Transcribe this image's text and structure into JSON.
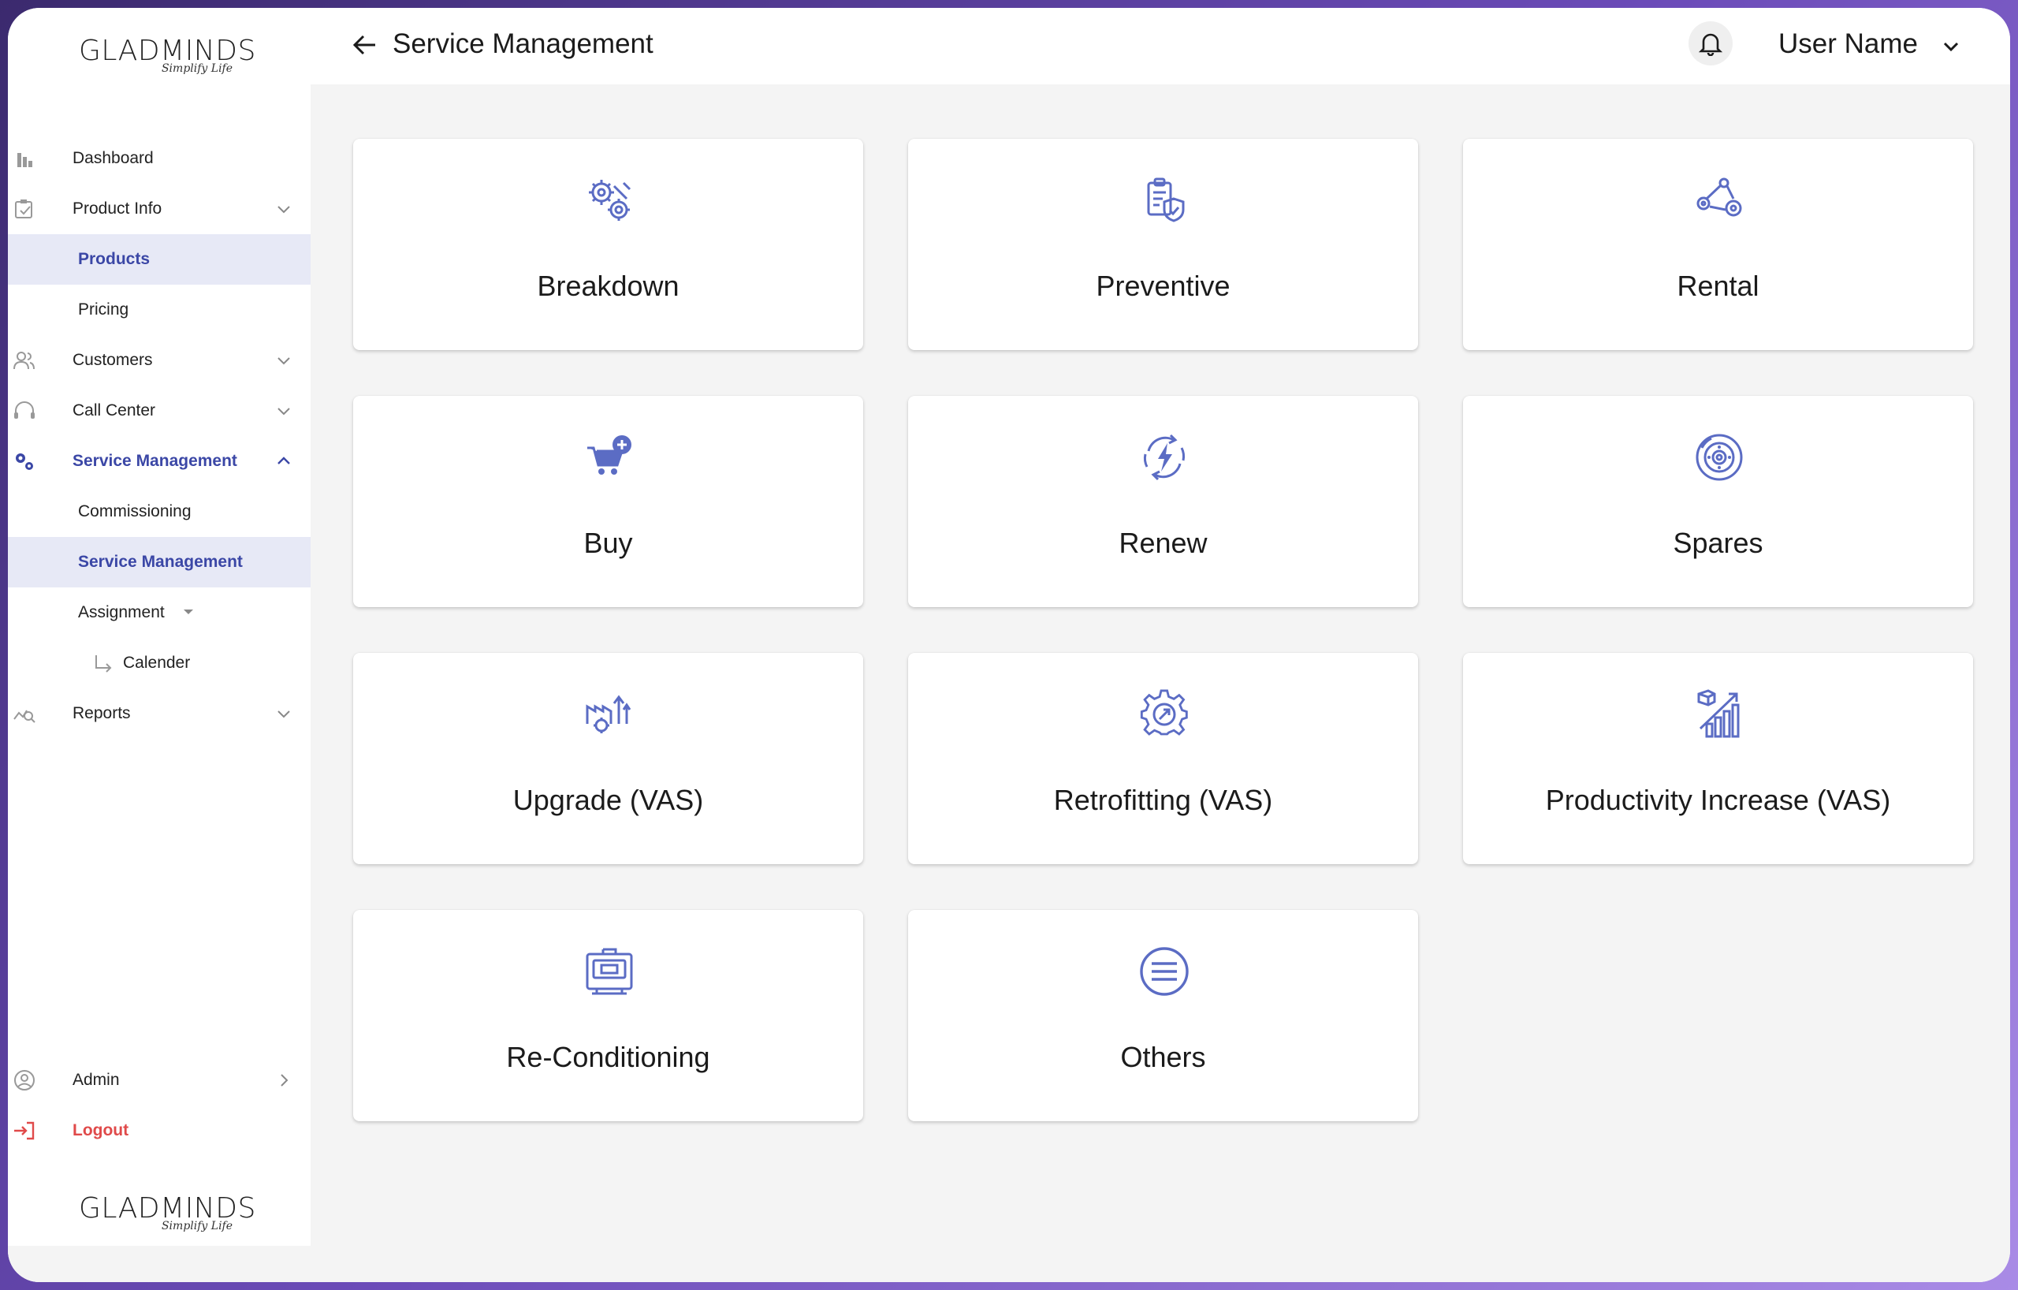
{
  "brand": {
    "name": "GLADMINDS",
    "tagline": "Simplify Life"
  },
  "header": {
    "title": "Service Management",
    "user_name": "User Name"
  },
  "sidebar": {
    "items": [
      {
        "label": "Dashboard"
      },
      {
        "label": "Product Info"
      },
      {
        "label": "Products"
      },
      {
        "label": "Pricing"
      },
      {
        "label": "Customers"
      },
      {
        "label": "Call Center"
      },
      {
        "label": "Service Management"
      },
      {
        "label": "Commissioning"
      },
      {
        "label": "Service Management"
      },
      {
        "label": "Assignment"
      },
      {
        "label": "Calender"
      },
      {
        "label": "Reports"
      }
    ],
    "admin": "Admin",
    "logout": "Logout"
  },
  "cards": [
    {
      "label": "Breakdown",
      "icon": "gears-wrench-icon"
    },
    {
      "label": "Preventive",
      "icon": "clipboard-shield-icon"
    },
    {
      "label": "Rental",
      "icon": "robot-arm-icon"
    },
    {
      "label": "Buy",
      "icon": "cart-plus-icon"
    },
    {
      "label": "Renew",
      "icon": "lightning-refresh-icon"
    },
    {
      "label": "Spares",
      "icon": "brake-disc-icon"
    },
    {
      "label": "Upgrade (VAS)",
      "icon": "factory-upgrade-icon"
    },
    {
      "label": "Retrofitting (VAS)",
      "icon": "gear-arrow-icon"
    },
    {
      "label": "Productivity Increase (VAS)",
      "icon": "growth-chart-icon"
    },
    {
      "label": "Re-Conditioning",
      "icon": "machine-toolbox-icon"
    },
    {
      "label": "Others",
      "icon": "menu-lines-icon"
    }
  ],
  "colors": {
    "accent": "#3b47a6",
    "icon": "#5b6cc4",
    "logout": "#e04a4a",
    "active_bg": "#e7e9f6"
  }
}
